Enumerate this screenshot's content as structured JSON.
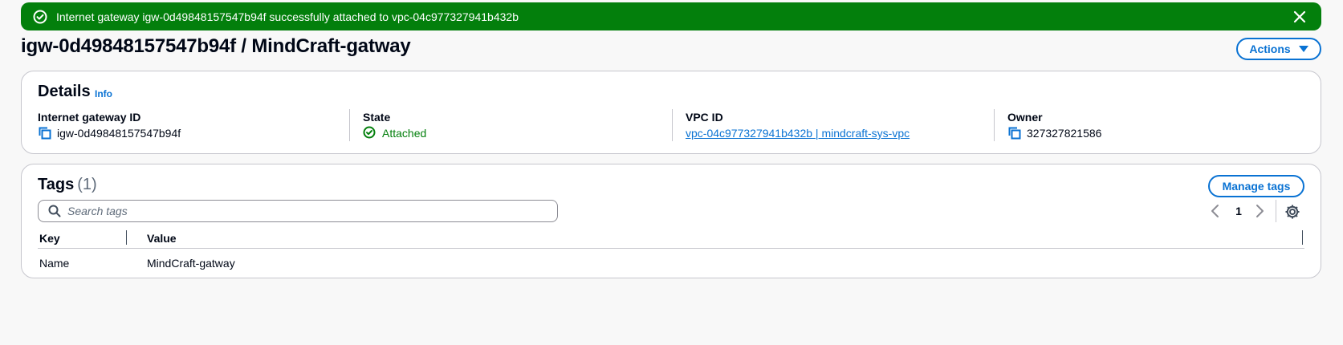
{
  "flash": {
    "message": "Internet gateway igw-0d49848157547b94f successfully attached to vpc-04c977327941b432b",
    "icon": "check-circle-icon",
    "color": "#037f0c"
  },
  "header": {
    "title": "igw-0d49848157547b94f / MindCraft-gatway",
    "actions_label": "Actions"
  },
  "details": {
    "title": "Details",
    "info_label": "Info",
    "fields": {
      "igw_label": "Internet gateway ID",
      "igw_value": "igw-0d49848157547b94f",
      "state_label": "State",
      "state_value": "Attached",
      "vpc_label": "VPC ID",
      "vpc_value": "vpc-04c977327941b432b | mindcraft-sys-vpc",
      "owner_label": "Owner",
      "owner_value": "327327821586"
    }
  },
  "tags": {
    "title": "Tags",
    "count": "(1)",
    "manage_label": "Manage tags",
    "search_placeholder": "Search tags",
    "page": "1",
    "columns": [
      "Key",
      "Value"
    ],
    "rows": [
      {
        "key": "Name",
        "value": "MindCraft-gatway"
      }
    ]
  },
  "colors": {
    "accent": "#0972d3",
    "success": "#037f0c"
  }
}
